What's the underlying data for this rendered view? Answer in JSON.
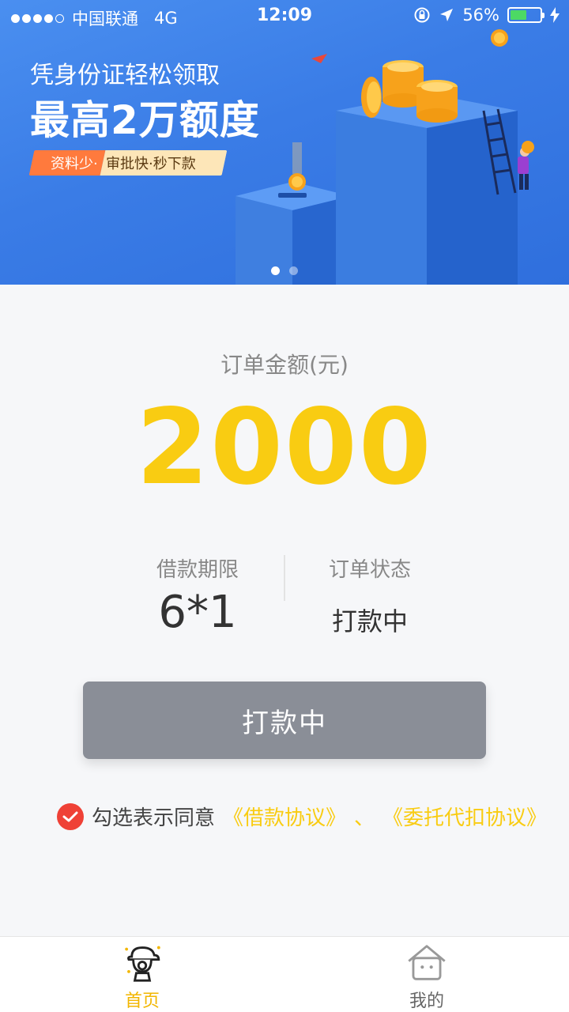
{
  "status_bar": {
    "carrier": "中国联通",
    "network": "4G",
    "time": "12:09",
    "battery": "56%",
    "battery_level": 0.56
  },
  "banner": {
    "subtitle": "凭身份证轻松领取",
    "title": "最高2万额度",
    "tag_part1": "资料少·",
    "tag_part2": "审批快·秒下款",
    "slide_count": 2,
    "active_slide": 1
  },
  "order": {
    "amount_label": "订单金额(元)",
    "amount_value": "2000",
    "term_label": "借款期限",
    "term_value": "6*1",
    "status_label": "订单状态",
    "status_value": "打款中"
  },
  "action_button": {
    "label": "打款中"
  },
  "agreement": {
    "text": "勾选表示同意",
    "link1": "《借款协议》",
    "separator": "、",
    "link2": "《委托代扣协议》"
  },
  "tab_bar": {
    "home_label": "首页",
    "mine_label": "我的"
  },
  "colors": {
    "accent": "#f9cc12",
    "banner_blue": "#3a7ce6",
    "button_gray": "#8a8e97",
    "check_red": "#ef4136"
  }
}
